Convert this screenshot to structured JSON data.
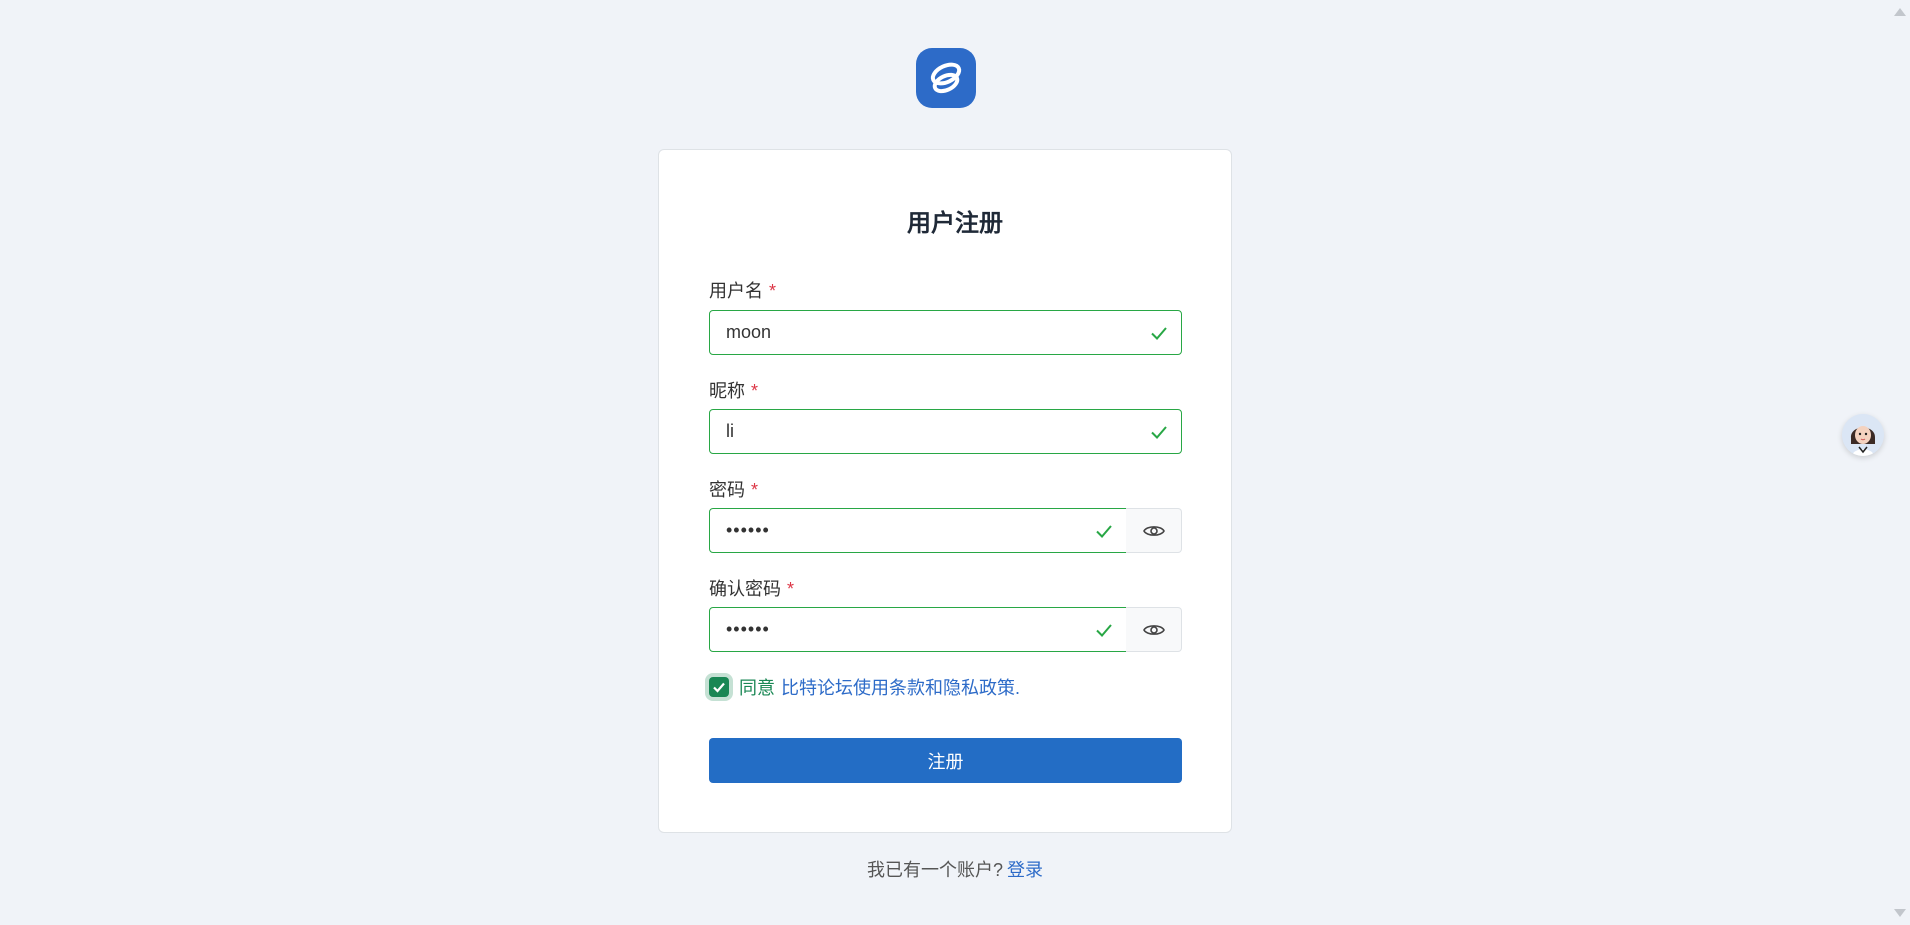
{
  "form": {
    "title": "用户注册",
    "required_mark": "*",
    "username": {
      "label": "用户名",
      "value": "moon"
    },
    "nickname": {
      "label": "昵称",
      "value": "li"
    },
    "password": {
      "label": "密码",
      "value": "••••••"
    },
    "confirm_password": {
      "label": "确认密码",
      "value": "••••••"
    },
    "agree": {
      "checked": true,
      "prefix": "同意",
      "link": "比特论坛使用条款和隐私政策."
    },
    "submit_label": "注册"
  },
  "footer": {
    "prompt": "我已有一个账户?",
    "login_link": "登录"
  },
  "icons": {
    "logo": "forum-logo-icon",
    "valid": "check-icon",
    "toggle_password": "eye-icon",
    "assistant": "assistant-avatar"
  },
  "colors": {
    "brand": "#2d6bc8",
    "valid": "#28a745",
    "required": "#dc3545",
    "background": "#f0f3f8"
  }
}
